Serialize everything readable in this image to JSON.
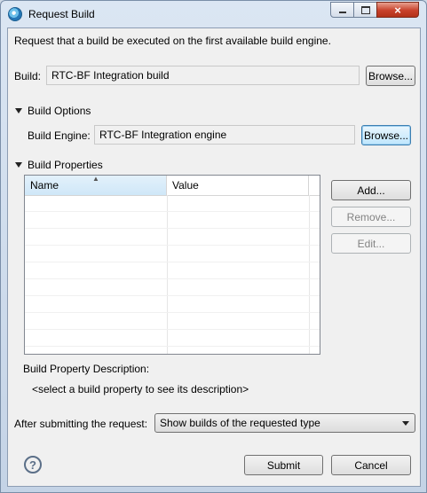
{
  "window": {
    "title": "Request Build",
    "min_symbol": "",
    "max_symbol": "",
    "close_symbol": "×"
  },
  "intro": "Request that a build be executed on the first available build engine.",
  "build": {
    "label": "Build:",
    "value": "RTC-BF Integration build",
    "browse_label": "Browse..."
  },
  "build_options": {
    "section_label": "Build Options",
    "engine_label": "Build Engine:",
    "engine_value": "RTC-BF Integration engine",
    "browse_label": "Browse..."
  },
  "build_properties": {
    "section_label": "Build Properties",
    "columns": [
      "Name",
      "Value"
    ],
    "rows": [],
    "add_label": "Add...",
    "remove_label": "Remove...",
    "edit_label": "Edit..."
  },
  "description": {
    "label": "Build Property Description:",
    "placeholder": "<select a build property to see its description>"
  },
  "after_submit": {
    "label": "After submitting the request:",
    "selected": "Show builds of the requested type"
  },
  "footer": {
    "help_icon": "question-circle",
    "help_glyph": "?",
    "submit_label": "Submit",
    "cancel_label": "Cancel"
  }
}
